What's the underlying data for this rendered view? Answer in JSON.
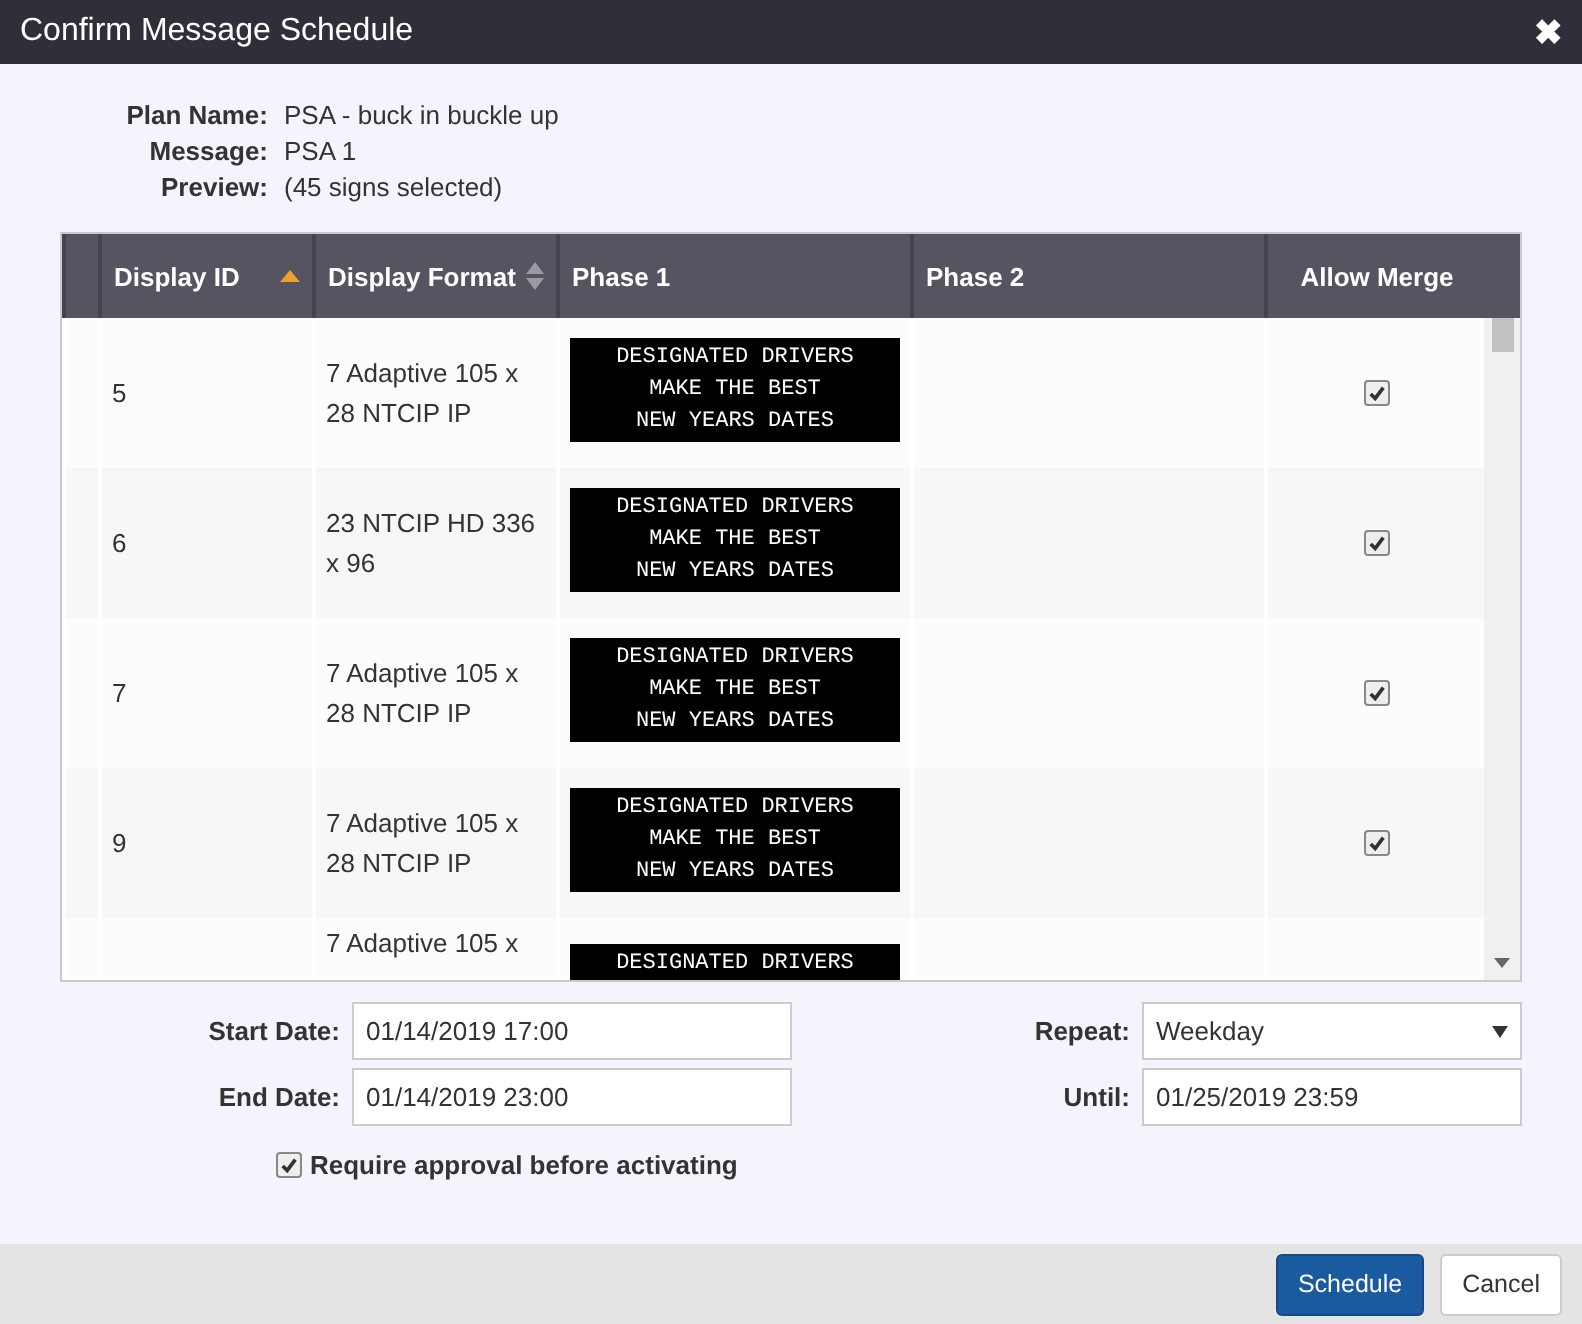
{
  "window": {
    "title": "Confirm Message Schedule",
    "close": "✖"
  },
  "summary": [
    {
      "label": "Plan Name:",
      "value": "PSA - buck in buckle up"
    },
    {
      "label": "Message:",
      "value": "PSA 1"
    },
    {
      "label": "Preview:",
      "value": "(45 signs selected)"
    }
  ],
  "table": {
    "columns": [
      {
        "label": "Display ID",
        "sorted": true
      },
      {
        "label": "Display Format",
        "sorted": false
      },
      {
        "label": "Phase 1"
      },
      {
        "label": "Phase 2"
      },
      {
        "label": "Allow Merge"
      }
    ],
    "rows": [
      {
        "id": "5",
        "format": "7 Adaptive 105 x 28 NTCIP IP",
        "phase1": [
          "DESIGNATED DRIVERS",
          "MAKE THE BEST",
          "NEW YEARS DATES"
        ],
        "checked": true
      },
      {
        "id": "6",
        "format": "23 NTCIP HD 336 x 96",
        "phase1": [
          "DESIGNATED DRIVERS",
          "MAKE THE BEST",
          "NEW YEARS DATES"
        ],
        "checked": true
      },
      {
        "id": "7",
        "format": "7 Adaptive 105 x 28 NTCIP IP",
        "phase1": [
          "DESIGNATED DRIVERS",
          "MAKE THE BEST",
          "NEW YEARS DATES"
        ],
        "checked": true
      },
      {
        "id": "9",
        "format": "7 Adaptive 105 x 28 NTCIP IP",
        "phase1": [
          "DESIGNATED DRIVERS",
          "MAKE THE BEST",
          "NEW YEARS DATES"
        ],
        "checked": true
      },
      {
        "format": "7 Adaptive 105 x",
        "phase1": [
          "DESIGNATED DRIVERS"
        ]
      }
    ]
  },
  "form": {
    "start_date": {
      "label": "Start Date:",
      "value": "01/14/2019 17:00"
    },
    "end_date": {
      "label": "End Date:",
      "value": "01/14/2019 23:00"
    },
    "repeat": {
      "label": "Repeat:",
      "value": "Weekday"
    },
    "until": {
      "label": "Until:",
      "value": "01/25/2019 23:59"
    },
    "require_approval": {
      "label": "Require approval before activating",
      "checked": true
    }
  },
  "buttons": [
    {
      "label": "Schedule",
      "kind": "primary"
    },
    {
      "label": "Cancel",
      "kind": "default"
    }
  ]
}
